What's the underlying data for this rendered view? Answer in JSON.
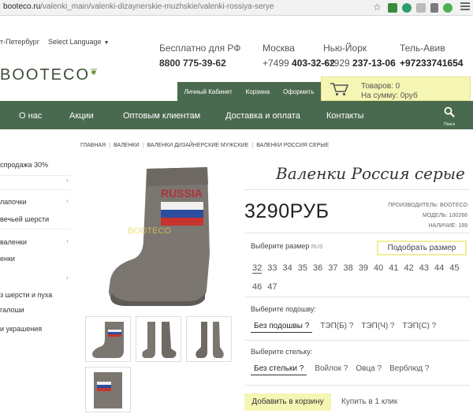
{
  "browser": {
    "url_domain": "booteco.ru",
    "url_path": "/valenki_main/valenki-dizaynerskie-muzhskie/valenki-rossiya-serye"
  },
  "topbar": {
    "city": "т-Петербург",
    "language_label": "Select Language",
    "contacts": [
      {
        "title": "Бесплатно для РФ",
        "code": "",
        "number": "8800 775-39-62"
      },
      {
        "title": "Москва",
        "code": "+7499 ",
        "number": "403-32-62"
      },
      {
        "title": "Нью-Йорк",
        "code": "+1929 ",
        "number": "237-13-06"
      },
      {
        "title": "Тель-Авив",
        "code": "",
        "number": "+97233741654"
      }
    ]
  },
  "logo": {
    "text": "BOOTECO"
  },
  "account": {
    "cabinet": "Личный Кабинет",
    "cart": "Корзина",
    "checkout": "Оформить"
  },
  "cart_box": {
    "goods": "Товаров: 0",
    "sum": "На сумму: 0руб"
  },
  "nav": {
    "items": [
      "О нас",
      "Акции",
      "Оптовым клиентам",
      "Доставка и оплата",
      "Контакты"
    ],
    "search_label": "Поиск"
  },
  "sidebar": {
    "items": [
      "спродажа 30%",
      "",
      "лапочки",
      "вечьей шерсти",
      "валенки",
      "енки",
      "",
      "з шерсти и пуха",
      "галоши",
      "и украшения"
    ]
  },
  "breadcrumb": [
    "Главная",
    "Валенки",
    "Валенки дизайнерские мужские",
    "Валенки Россия серые"
  ],
  "product": {
    "title": "Валенки Россия серые",
    "price": "3290РУБ",
    "manufacturer": "ПРОИЗВОДИТЕЛЬ: BOOTECO",
    "model": "МОДЕЛЬ: 100266",
    "availability": "НАЛИЧИЕ: 189",
    "image_text": "RUSSIA",
    "watermark": "BOOTECO"
  },
  "size": {
    "label": "Выберите размер",
    "unit": "RUS",
    "fit_button": "Подобрать размер",
    "options": [
      "32",
      "33",
      "34",
      "35",
      "36",
      "37",
      "38",
      "39",
      "40",
      "41",
      "42",
      "43",
      "44",
      "45",
      "46",
      "47"
    ],
    "selected": "32"
  },
  "sole": {
    "label": "Выберите подошву:",
    "options": [
      "Без подошвы ?",
      "ТЭП(Б) ?",
      "ТЭП(Ч) ?",
      "ТЭП(С) ?"
    ]
  },
  "insole": {
    "label": "Выберите стельку:",
    "options": [
      "Без стельки ?",
      "Войлок ?",
      "Овца ?",
      "Верблюд ?"
    ]
  },
  "actions": {
    "add_to_cart": "Добавить в корзину",
    "one_click": "Купить в 1 клик"
  },
  "colors": {
    "brand_green": "#4a6a4f",
    "highlight_yellow": "#f6f6b4"
  }
}
